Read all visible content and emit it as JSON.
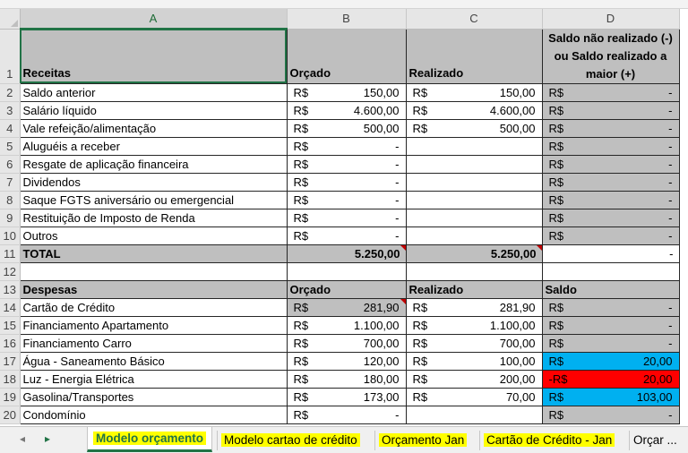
{
  "columns": [
    "A",
    "B",
    "C",
    "D"
  ],
  "rows": [
    {
      "n": "1",
      "a": "Receitas",
      "b": "Orçado",
      "c": "Realizado",
      "d": "Saldo não realizado (-) ou Saldo realizado a maior (+)"
    },
    {
      "n": "2",
      "a": "Saldo anterior",
      "b_sym": "R$",
      "b_val": "150,00",
      "c_sym": "R$",
      "c_val": "150,00",
      "d_sym": "R$",
      "d_val": "-"
    },
    {
      "n": "3",
      "a": "Salário líquido",
      "b_sym": "R$",
      "b_val": "4.600,00",
      "c_sym": "R$",
      "c_val": "4.600,00",
      "d_sym": "R$",
      "d_val": "-"
    },
    {
      "n": "4",
      "a": "Vale refeição/alimentação",
      "b_sym": "R$",
      "b_val": "500,00",
      "c_sym": "R$",
      "c_val": "500,00",
      "d_sym": "R$",
      "d_val": "-"
    },
    {
      "n": "5",
      "a": "Aluguéis a receber",
      "b_sym": "R$",
      "b_val": "-",
      "d_sym": "R$",
      "d_val": "-"
    },
    {
      "n": "6",
      "a": "Resgate de aplicação financeira",
      "b_sym": "R$",
      "b_val": "-",
      "d_sym": "R$",
      "d_val": "-"
    },
    {
      "n": "7",
      "a": "Dividendos",
      "b_sym": "R$",
      "b_val": "-",
      "d_sym": "R$",
      "d_val": "-"
    },
    {
      "n": "8",
      "a": "Saque FGTS aniversário ou emergencial",
      "b_sym": "R$",
      "b_val": "-",
      "d_sym": "R$",
      "d_val": "-"
    },
    {
      "n": "9",
      "a": "Restituição de Imposto de Renda",
      "b_sym": "R$",
      "b_val": "-",
      "d_sym": "R$",
      "d_val": "-"
    },
    {
      "n": "10",
      "a": "Outros",
      "b_sym": "R$",
      "b_val": "-",
      "d_sym": "R$",
      "d_val": "-"
    },
    {
      "n": "11",
      "a": "TOTAL",
      "b_val": "5.250,00",
      "c_val": "5.250,00",
      "d_val": "-"
    },
    {
      "n": "12"
    },
    {
      "n": "13",
      "a": "Despesas",
      "b": "Orçado",
      "c": "Realizado",
      "d": "Saldo"
    },
    {
      "n": "14",
      "a": "Cartão de Crédito",
      "b_sym": "R$",
      "b_val": "281,90",
      "c_sym": "R$",
      "c_val": "281,90",
      "d_sym": "R$",
      "d_val": "-"
    },
    {
      "n": "15",
      "a": "Financiamento Apartamento",
      "b_sym": "R$",
      "b_val": "1.100,00",
      "c_sym": "R$",
      "c_val": "1.100,00",
      "d_sym": "R$",
      "d_val": "-"
    },
    {
      "n": "16",
      "a": "Financiamento Carro",
      "b_sym": "R$",
      "b_val": "700,00",
      "c_sym": "R$",
      "c_val": "700,00",
      "d_sym": "R$",
      "d_val": "-"
    },
    {
      "n": "17",
      "a": "Água - Saneamento Básico",
      "b_sym": "R$",
      "b_val": "120,00",
      "c_sym": "R$",
      "c_val": "100,00",
      "d_sym": "R$",
      "d_val": "20,00"
    },
    {
      "n": "18",
      "a": "Luz - Energia Elétrica",
      "b_sym": "R$",
      "b_val": "180,00",
      "c_sym": "R$",
      "c_val": "200,00",
      "d_sym": "-R$",
      "d_val": "20,00"
    },
    {
      "n": "19",
      "a": "Gasolina/Transportes",
      "b_sym": "R$",
      "b_val": "173,00",
      "c_sym": "R$",
      "c_val": "70,00",
      "d_sym": "R$",
      "d_val": "103,00"
    },
    {
      "n": "20",
      "a": "Condomínio",
      "b_sym": "R$",
      "b_val": "-",
      "d_sym": "R$",
      "d_val": "-"
    }
  ],
  "tabs": [
    {
      "label": "Modelo orçamento"
    },
    {
      "label": "Modelo cartao de crédito"
    },
    {
      "label": "Orçamento Jan"
    },
    {
      "label": "Cartão de Crédito - Jan"
    },
    {
      "label": "Orçar"
    }
  ],
  "tabbar": {
    "prev_icon": "◂",
    "next_icon": "▸",
    "more": "..."
  },
  "colors": {
    "accent": "#217346",
    "gray": "#bfbfbf",
    "positive": "#00b0f0",
    "negative": "#ff0000",
    "tab_highlight": "#ffff00"
  }
}
